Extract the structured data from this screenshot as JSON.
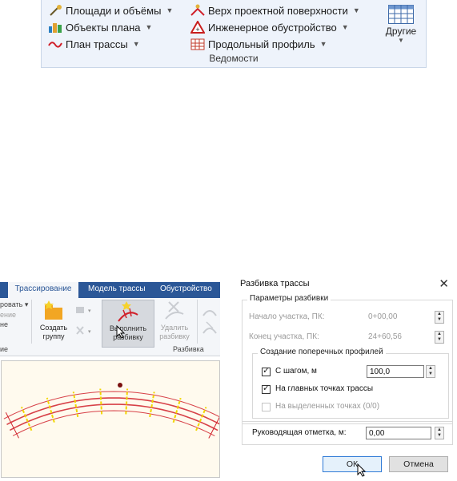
{
  "ribbon_top": {
    "items": [
      {
        "label": "Площади и объёмы",
        "icon": "area-volume-icon"
      },
      {
        "label": "Объекты плана",
        "icon": "plan-objects-icon"
      },
      {
        "label": "План трассы",
        "icon": "route-plan-icon"
      },
      {
        "label": "Верх проектной поверхности",
        "icon": "design-surface-top-icon"
      },
      {
        "label": "Инженерное обустройство",
        "icon": "engineering-equipment-icon"
      },
      {
        "label": "Продольный профиль",
        "icon": "longitudinal-profile-icon"
      }
    ],
    "other_label": "Другие",
    "group_label": "Ведомости"
  },
  "ribbon2": {
    "tabs": [
      "Трассирование",
      "Модель трассы",
      "Обустройство"
    ],
    "left_fragments": [
      "ровать",
      "ение",
      "не",
      "ие"
    ],
    "create_group_label": "Создать группу",
    "run_label": "Выполнить разбивку",
    "delete_label": "Удалить разбивку",
    "panel_label": "Разбивка"
  },
  "dialog": {
    "title": "Разбивка трассы",
    "params_legend": "Параметры разбивки",
    "start_label": "Начало участка, ПК:",
    "start_value": "0+00,00",
    "end_label": "Конец участка, ПК:",
    "end_value": "24+60,56",
    "profiles_legend": "Создание поперечных профилей",
    "step_label": "С шагом, м",
    "step_value": "100,0",
    "step_checked": true,
    "main_points_label": "На главных точках трассы",
    "main_points_checked": true,
    "selected_points_label": "На выделенных точках (0/0)",
    "selected_points_checked": false,
    "guide_label": "Руководящая отметка, м:",
    "guide_value": "0,00",
    "ok_label": "ОК",
    "cancel_label": "Отмена"
  },
  "colors": {
    "ribbon_tab_bar": "#2b5797",
    "route_red": "#d0202a",
    "stake_yellow": "#f2d600",
    "drawing_bg": "#fffaee"
  }
}
